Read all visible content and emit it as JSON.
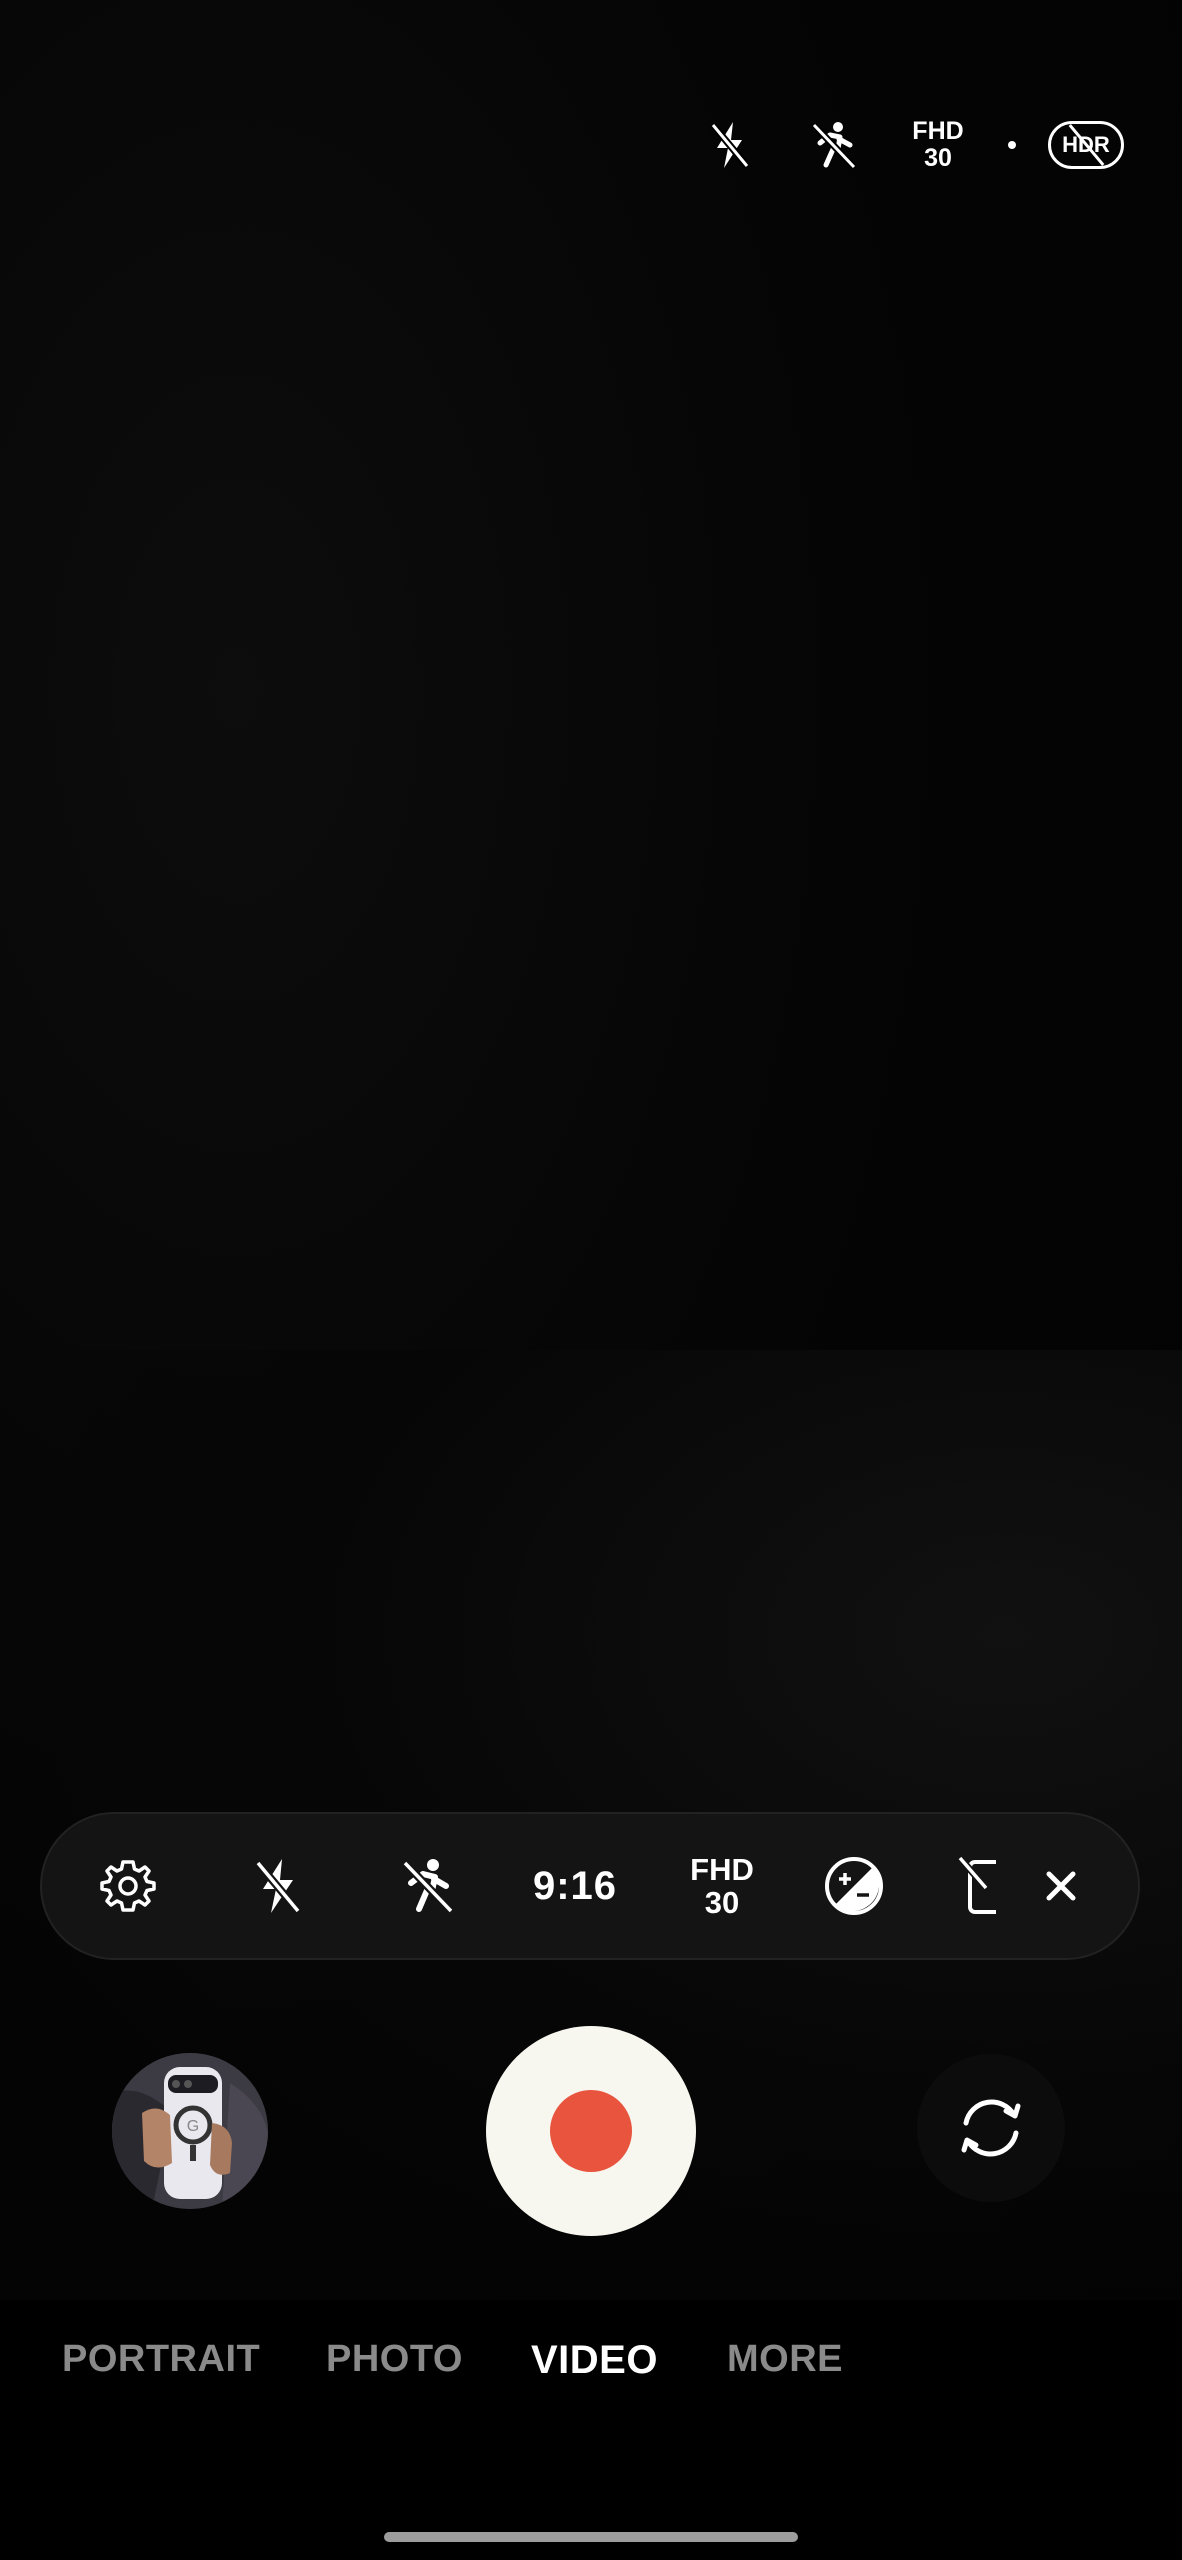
{
  "top_bar": {
    "flash_icon": "flash-off-icon",
    "motion_icon": "motion-photo-off-icon",
    "resolution_top": "FHD",
    "resolution_bottom": "30",
    "hdr_label": "HDR",
    "hdr_state": "off"
  },
  "settings_pill": {
    "settings_icon": "gear-icon",
    "flash_icon": "flash-off-icon",
    "motion_icon": "motion-photo-off-icon",
    "aspect_ratio": "9:16",
    "resolution_top": "FHD",
    "resolution_bottom": "30",
    "exposure_icon": "exposure-icon",
    "stabilization_icon": "stabilization-off-icon",
    "close_icon": "close-icon"
  },
  "capture": {
    "gallery_icon": "gallery-thumbnail",
    "record_color": "#e8543e",
    "shutter_color": "#f7f6ef",
    "flip_icon": "switch-camera-icon"
  },
  "modes": [
    {
      "label": "PORTRAIT",
      "active": false
    },
    {
      "label": "PHOTO",
      "active": false
    },
    {
      "label": "VIDEO",
      "active": true
    },
    {
      "label": "MORE",
      "active": false
    }
  ]
}
